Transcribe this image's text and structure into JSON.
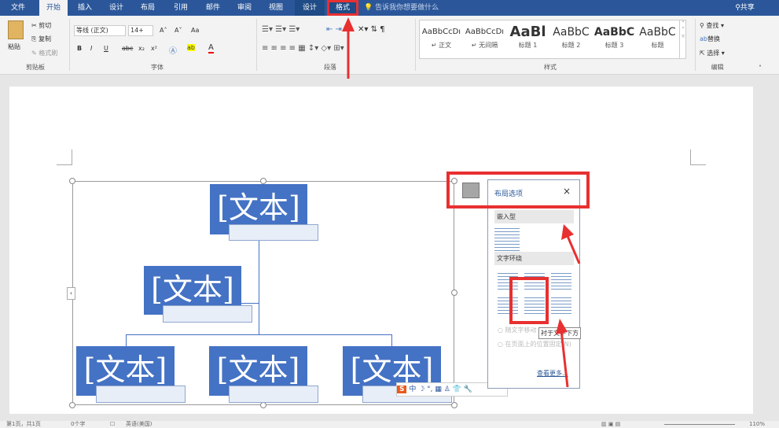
{
  "tabs": [
    "文件",
    "开始",
    "插入",
    "设计",
    "布局",
    "引用",
    "邮件",
    "审阅",
    "视图",
    "设计",
    "格式"
  ],
  "tell_me": "告诉我你想要做什么",
  "share": "共享",
  "clipboard": {
    "paste": "粘贴",
    "cut": "剪切",
    "copy": "复制",
    "format_painter": "格式刷",
    "group": "剪贴板"
  },
  "font": {
    "name": "等线 (正文)",
    "size": "14+",
    "group": "字体",
    "bold": "B",
    "italic": "I",
    "underline": "U",
    "strike": "abc",
    "sub": "x₂",
    "sup": "x²",
    "grow": "A˄",
    "shrink": "A˅",
    "case": "Aa"
  },
  "paragraph": {
    "group": "段落"
  },
  "styles": {
    "group": "样式",
    "items": [
      {
        "preview": "AaBbCcDı",
        "name": "↵ 正文"
      },
      {
        "preview": "AaBbCcDı",
        "name": "↵ 无间隔"
      },
      {
        "preview": "AaBl",
        "name": "标题 1"
      },
      {
        "preview": "AaBbC",
        "name": "标题 2"
      },
      {
        "preview": "AaBbC",
        "name": "标题 3"
      },
      {
        "preview": "AaBbC",
        "name": "标题"
      }
    ]
  },
  "editing": {
    "find": "查找",
    "replace": "替换",
    "select": "选择",
    "group": "编辑"
  },
  "smartart": {
    "node_text": "[文本]"
  },
  "layout_panel": {
    "title": "布局选项",
    "close": "×",
    "inline": "嵌入型",
    "wrap": "文字环绕",
    "move_with_text": "随文字移动",
    "fix_position": "在页面上的位置固定(N)",
    "see_more": "查看更多...",
    "tooltip": "衬于文字下方"
  },
  "ime": {
    "logo": "S",
    "mode": "中"
  },
  "status": {
    "page": "第1页，共1页",
    "words": "0个字",
    "lang": "英语(美国)",
    "zoom": "110%"
  },
  "colors": {
    "accent": "#2b579a",
    "node": "#4472c4",
    "highlight": "#e83030"
  }
}
